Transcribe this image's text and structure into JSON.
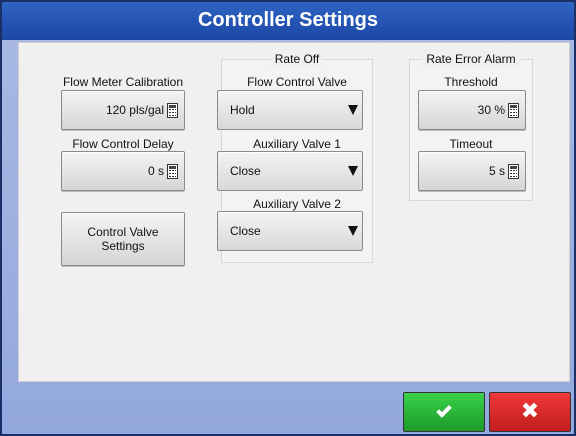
{
  "window": {
    "title": "Controller Settings"
  },
  "left": {
    "flow_meter_calibration_label": "Flow Meter Calibration",
    "flow_meter_calibration_value": "120 pls/gal",
    "flow_control_delay_label": "Flow Control Delay",
    "flow_control_delay_value": "0 s",
    "control_valve_settings_label": "Control Valve Settings"
  },
  "rate_off": {
    "title": "Rate Off",
    "flow_control_valve_label": "Flow Control Valve",
    "flow_control_valve_value": "Hold",
    "auxiliary_valve_1_label": "Auxiliary Valve 1",
    "auxiliary_valve_1_value": "Close",
    "auxiliary_valve_2_label": "Auxiliary Valve 2",
    "auxiliary_valve_2_value": "Close"
  },
  "rate_error_alarm": {
    "title": "Rate Error Alarm",
    "threshold_label": "Threshold",
    "threshold_value": "30 %",
    "timeout_label": "Timeout",
    "timeout_value": "5 s"
  },
  "footer": {
    "ok_icon": "checkmark-icon",
    "cancel_icon": "close-icon",
    "cancel_glyph": "✖"
  },
  "colors": {
    "title_bar": "#1c47a4",
    "ok": "#1d9b2b",
    "cancel": "#c21d1d"
  }
}
